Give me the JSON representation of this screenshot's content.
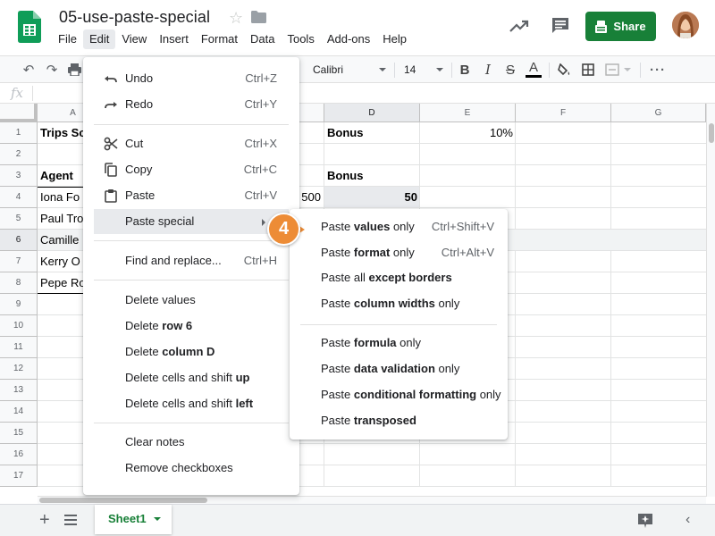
{
  "app": {
    "doc_title": "05-use-paste-special",
    "menus": [
      "File",
      "Edit",
      "View",
      "Insert",
      "Format",
      "Data",
      "Tools",
      "Add-ons",
      "Help"
    ],
    "active_menu": "Edit",
    "share_label": "Share",
    "brand_color": "#188038"
  },
  "toolbar": {
    "font": "Calibri",
    "font_size": "14"
  },
  "formula_bar": {
    "fx_label": "fx"
  },
  "grid": {
    "columns": [
      "A",
      "B",
      "C",
      "D",
      "E",
      "F",
      "G"
    ],
    "selected_column": "D",
    "rows": [
      "1",
      "2",
      "3",
      "4",
      "5",
      "6",
      "7",
      "8",
      "9",
      "10",
      "11",
      "12",
      "13",
      "14",
      "15",
      "16",
      "17"
    ],
    "selected_row": "6",
    "cells": {
      "A1": "Trips Sc",
      "A3": "Agent",
      "A4": "Iona Fo",
      "A5": "Paul Tro",
      "A6": "Camille",
      "A7": "Kerry O",
      "A8": "Pepe Ro",
      "C4": "500",
      "D1": "Bonus",
      "D3": "Bonus",
      "D4": "50",
      "E1": "10%"
    }
  },
  "edit_menu": {
    "items": [
      {
        "icon": "undo-icon",
        "label": "Undo",
        "shortcut": "Ctrl+Z"
      },
      {
        "icon": "redo-icon",
        "label": "Redo",
        "shortcut": "Ctrl+Y"
      },
      {
        "icon": "cut-icon",
        "label": "Cut",
        "shortcut": "Ctrl+X"
      },
      {
        "icon": "copy-icon",
        "label": "Copy",
        "shortcut": "Ctrl+C"
      },
      {
        "icon": "paste-icon",
        "label": "Paste",
        "shortcut": "Ctrl+V"
      },
      {
        "label": "Paste special"
      },
      {
        "label": "Find and replace...",
        "shortcut": "Ctrl+H"
      },
      {
        "label": "Delete values"
      },
      {
        "label_prefix": "Delete ",
        "label_bold": "row 6"
      },
      {
        "label_prefix": "Delete ",
        "label_bold": "column D"
      },
      {
        "label_prefix": "Delete cells and shift ",
        "label_bold": "up"
      },
      {
        "label_prefix": "Delete cells and shift ",
        "label_bold": "left"
      },
      {
        "label": "Clear notes"
      },
      {
        "label": "Remove checkboxes"
      }
    ]
  },
  "paste_special_menu": {
    "items": [
      {
        "prefix": "Paste ",
        "bold": "values",
        "suffix": " only",
        "shortcut": "Ctrl+Shift+V"
      },
      {
        "prefix": "Paste ",
        "bold": "format",
        "suffix": " only",
        "shortcut": "Ctrl+Alt+V"
      },
      {
        "prefix": "Paste all ",
        "bold": "except borders",
        "suffix": ""
      },
      {
        "prefix": "Paste ",
        "bold": "column widths",
        "suffix": " only"
      },
      {
        "prefix": "Paste ",
        "bold": "formula",
        "suffix": " only"
      },
      {
        "prefix": "Paste ",
        "bold": "data validation",
        "suffix": " only"
      },
      {
        "prefix": "Paste ",
        "bold": "conditional formatting",
        "suffix": " only"
      },
      {
        "prefix": "Paste ",
        "bold": "transposed",
        "suffix": ""
      }
    ]
  },
  "sheets": {
    "active_tab": "Sheet1"
  },
  "callout": {
    "step": "4",
    "color": "#ed8c36"
  }
}
